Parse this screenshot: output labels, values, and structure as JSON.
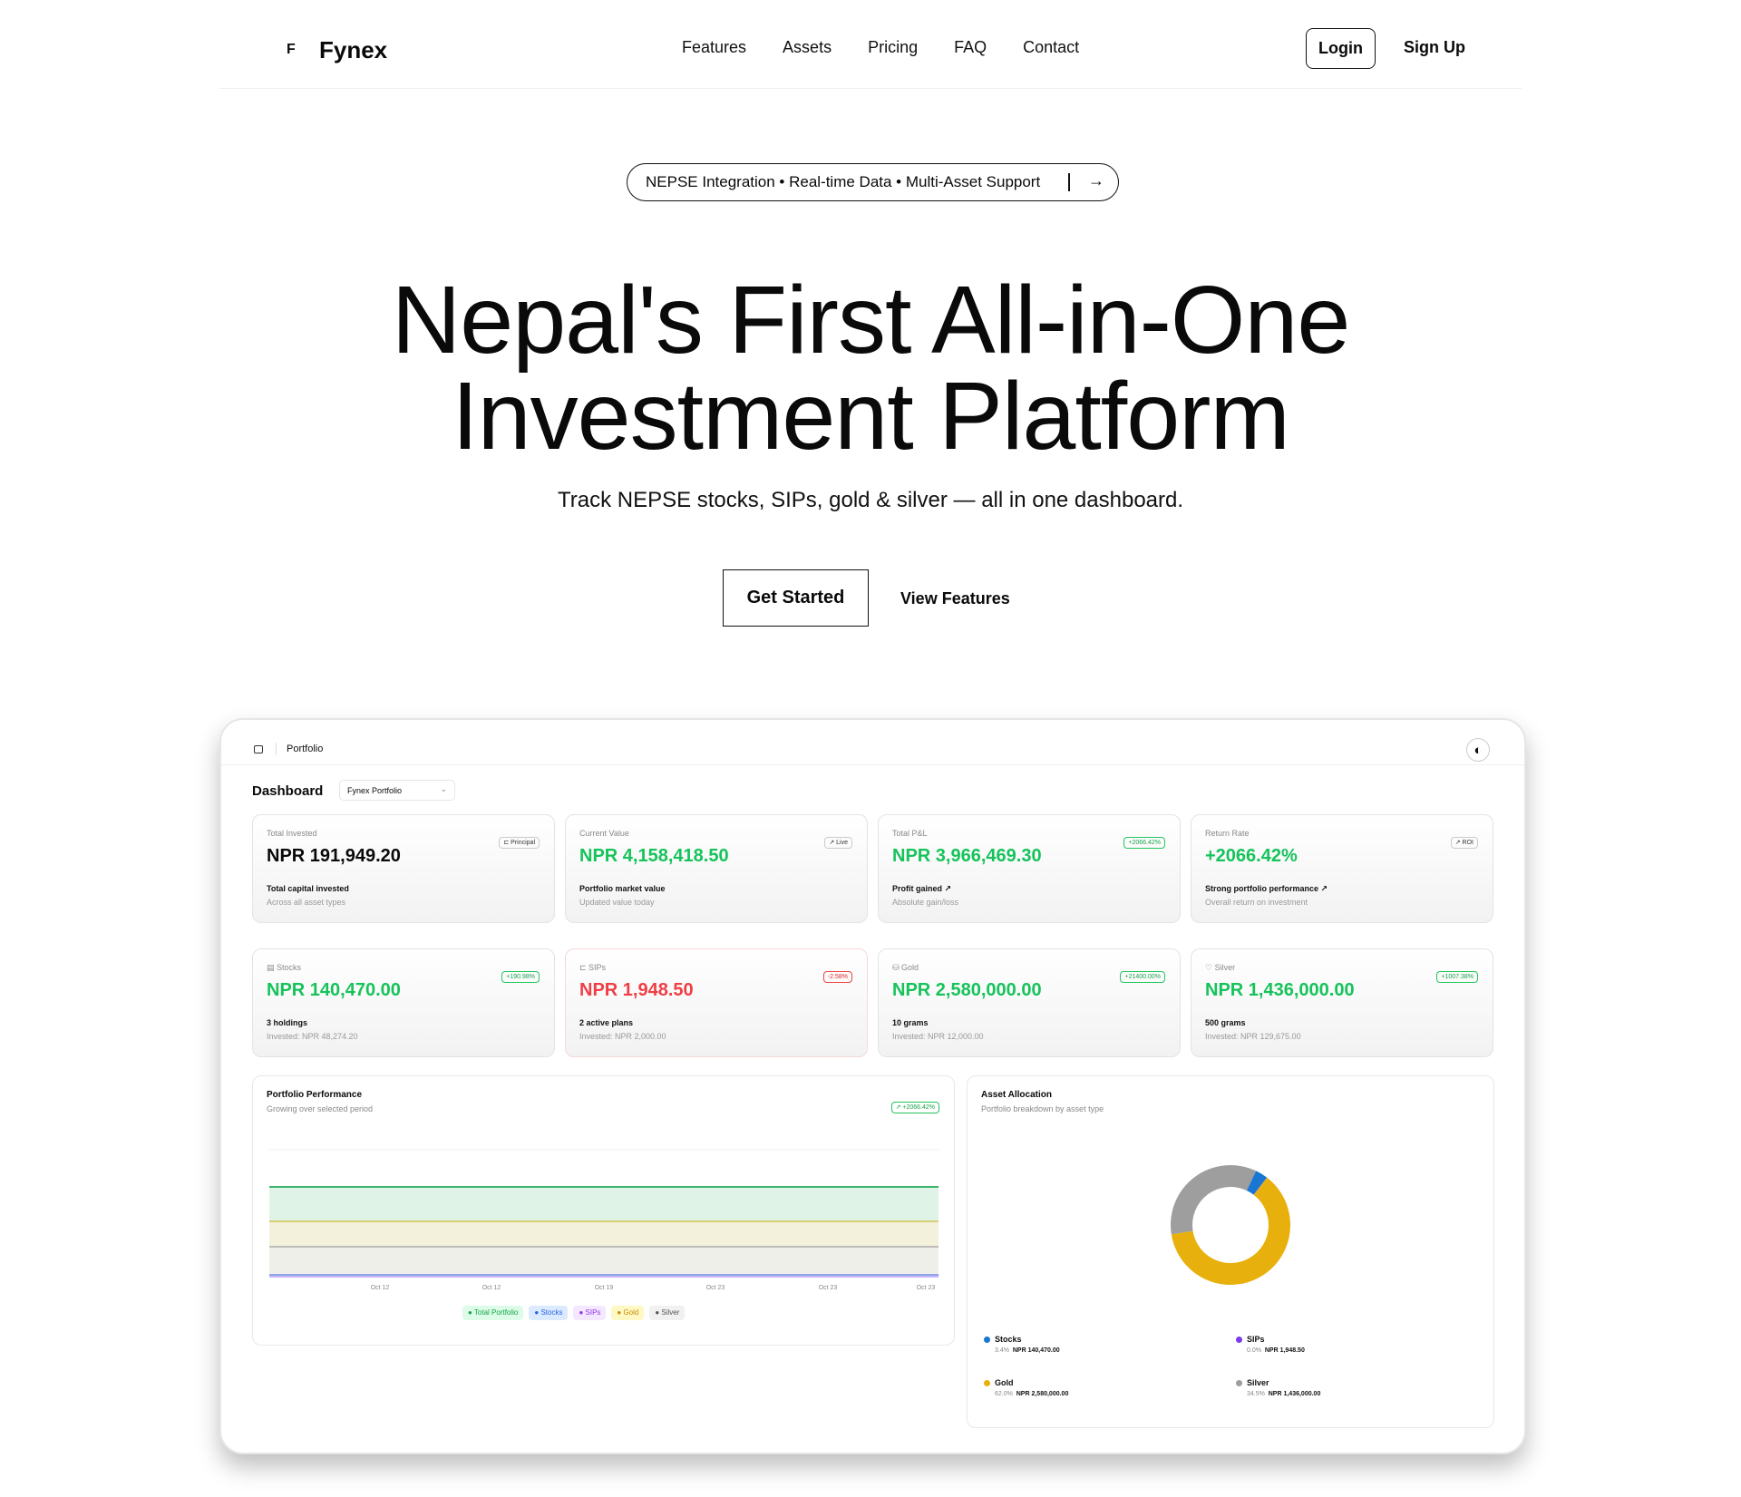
{
  "brand": {
    "mark": "F",
    "name": "Fynex"
  },
  "nav": {
    "links": [
      "Features",
      "Assets",
      "Pricing",
      "FAQ",
      "Contact"
    ],
    "login": "Login",
    "signup": "Sign Up"
  },
  "hero": {
    "pill": "NEPSE Integration • Real-time Data • Multi-Asset Support",
    "title_line1": "Nepal's First All-in-One",
    "title_line2": "Investment Platform",
    "subtitle": "Track NEPSE stocks, SIPs, gold & silver — all in one dashboard.",
    "cta_primary": "Get Started",
    "cta_secondary": "View Features"
  },
  "dashboard": {
    "breadcrumb": "Portfolio",
    "title": "Dashboard",
    "portfolio_select": "Fynex Portfolio",
    "summary": [
      {
        "label": "Total Invested",
        "value": "NPR 191,949.20",
        "badge": "⊏ Principal",
        "sub1": "Total capital invested",
        "sub2": "Across all asset types",
        "tone": "neutral",
        "badge_tone": ""
      },
      {
        "label": "Current Value",
        "value": "NPR 4,158,418.50",
        "badge": "↗ Live",
        "sub1": "Portfolio market value",
        "sub2": "Updated value today",
        "tone": "green",
        "badge_tone": ""
      },
      {
        "label": "Total P&L",
        "value": "NPR 3,966,469.30",
        "badge": "+2066.42%",
        "sub1": "Profit gained ↗",
        "sub2": "Absolute gain/loss",
        "tone": "green",
        "badge_tone": "pos"
      },
      {
        "label": "Return Rate",
        "value": "+2066.42%",
        "badge": "↗ ROI",
        "sub1": "Strong portfolio performance ↗",
        "sub2": "Overall return on investment",
        "tone": "green",
        "badge_tone": ""
      }
    ],
    "assets": [
      {
        "label": "▤ Stocks",
        "value": "NPR 140,470.00",
        "badge": "+190.98%",
        "sub1": "3 holdings",
        "sub2": "Invested: NPR 48,274.20",
        "tone": "green",
        "badge_tone": "pos"
      },
      {
        "label": "⊏ SIPs",
        "value": "NPR 1,948.50",
        "badge": "-2.58%",
        "sub1": "2 active plans",
        "sub2": "Invested: NPR 2,000.00",
        "tone": "red",
        "badge_tone": "neg"
      },
      {
        "label": "⛁ Gold",
        "value": "NPR 2,580,000.00",
        "badge": "+21400.00%",
        "sub1": "10 grams",
        "sub2": "Invested: NPR 12,000.00",
        "tone": "green",
        "badge_tone": "pos"
      },
      {
        "label": "♡ Silver",
        "value": "NPR 1,436,000.00",
        "badge": "+1007.38%",
        "sub1": "500 grams",
        "sub2": "Invested: NPR 129,675.00",
        "tone": "green",
        "badge_tone": "pos"
      }
    ],
    "performance": {
      "title": "Portfolio Performance",
      "subtitle": "Growing over selected period",
      "badge": "↗ +2066.42%",
      "x_ticks": [
        "Oct 12",
        "Oct 12",
        "Oct 19",
        "Oct 23",
        "Oct 23",
        "Oct 23"
      ],
      "legend": [
        {
          "name": "● Total Portfolio",
          "color": "#16a34a",
          "bg": "#dcfce7"
        },
        {
          "name": "● Stocks",
          "color": "#2563eb",
          "bg": "#dbeafe"
        },
        {
          "name": "● SIPs",
          "color": "#9333ea",
          "bg": "#f3e8ff"
        },
        {
          "name": "● Gold",
          "color": "#ca8a04",
          "bg": "#fef9c3"
        },
        {
          "name": "● Silver",
          "color": "#555555",
          "bg": "#f1f1f1"
        }
      ]
    },
    "allocation": {
      "title": "Asset Allocation",
      "subtitle": "Portfolio breakdown by asset type",
      "items": [
        {
          "name": "Stocks",
          "pct": "3.4%",
          "amount": "NPR 140,470.00",
          "share": 0.034,
          "color": "#1976d2"
        },
        {
          "name": "SIPs",
          "pct": "0.0%",
          "amount": "NPR 1,948.50",
          "share": 0.0005,
          "color": "#7c3aed"
        },
        {
          "name": "Gold",
          "pct": "62.0%",
          "amount": "NPR 2,580,000.00",
          "share": 0.62,
          "color": "#e8b00c"
        },
        {
          "name": "Silver",
          "pct": "34.5%",
          "amount": "NPR 1,436,000.00",
          "share": 0.345,
          "color": "#9e9e9e"
        }
      ]
    }
  },
  "colors": {
    "positive": "#16c35b",
    "negative": "#ef3e45",
    "text": "#0a0a0a"
  }
}
